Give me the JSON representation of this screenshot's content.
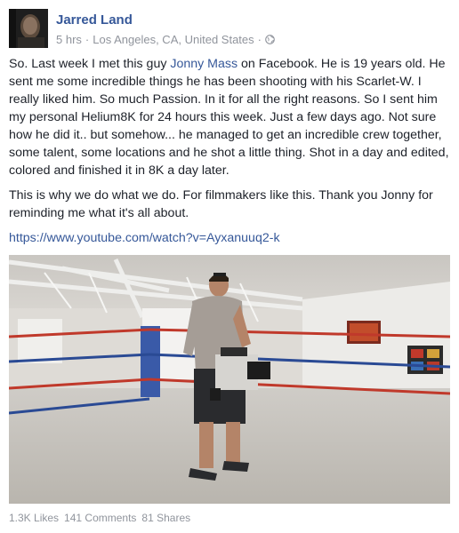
{
  "post": {
    "author": "Jarred Land",
    "meta": {
      "time": "5 hrs",
      "separator": "·",
      "location": "Los Angeles, CA, United States",
      "separator2": "·"
    },
    "paragraph1": {
      "before_link": "So. Last week I met this guy ",
      "mention": "Jonny Mass",
      "after_link": " on Facebook. He is 19 years old. He sent me some incredible things he has been shooting with his Scarlet-W. I really liked him. So much Passion. In it for all the right reasons. So I sent him my personal Helium8K for 24 hours this week. Just a few days ago. Not sure how he did it.. but somehow... he managed to get an incredible crew together, some talent, some locations and he shot a little thing. Shot in a day and edited, colored and finished it in 8K a day later."
    },
    "paragraph2": "This is why we do what we do. For filmmakers like this. Thank you Jonny for reminding me what it's all about.",
    "url": "https://www.youtube.com/watch?v=Ayxanuuq2-k",
    "stats": {
      "likes": "1.3K Likes",
      "comments": "141 Comments",
      "shares": "81 Shares"
    },
    "icons": {
      "privacy": "globe-icon"
    }
  }
}
